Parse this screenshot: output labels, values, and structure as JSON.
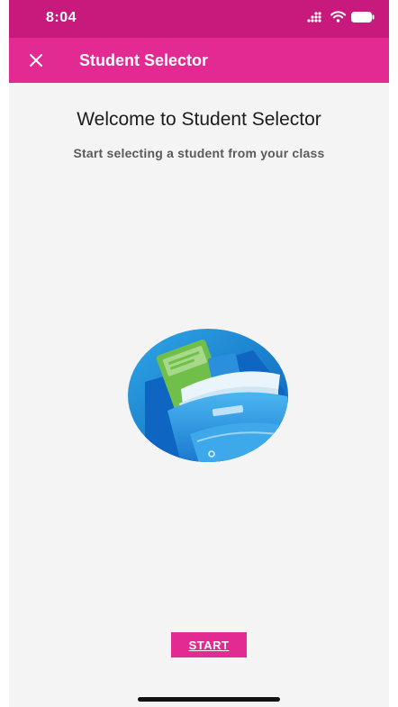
{
  "status_bar": {
    "time": "8:04",
    "icons": [
      "cellular-signal-icon",
      "wifi-icon",
      "battery-icon"
    ]
  },
  "app_bar": {
    "title": "Student Selector",
    "close_icon": "close-icon",
    "color": "#e22a92"
  },
  "welcome": {
    "title": "Welcome to Student Selector",
    "subtitle": "Start selecting a student from your class"
  },
  "illustration": {
    "icon": "school-bag-with-books-icon"
  },
  "actions": {
    "start_label": "START"
  },
  "colors": {
    "status_bar": "#c8197d",
    "accent": "#e22a92",
    "background": "#f4f4f4"
  }
}
